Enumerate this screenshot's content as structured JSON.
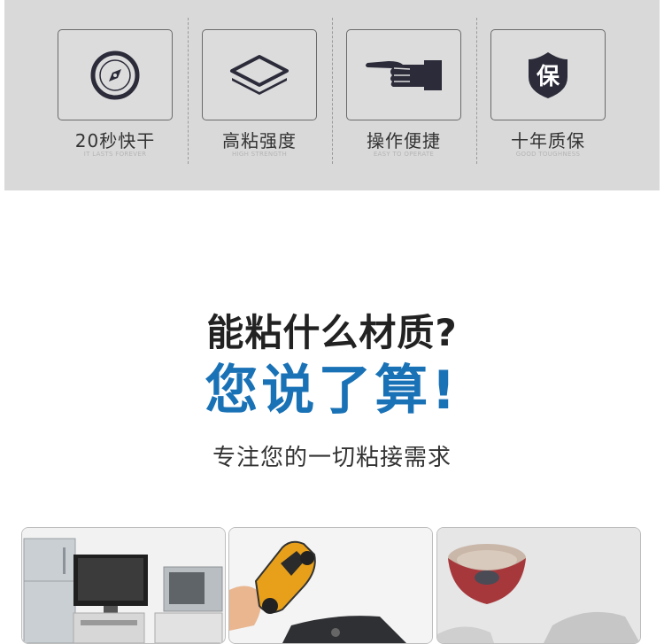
{
  "features": [
    {
      "title": "20秒快干",
      "subtitle": "IT LASTS FOREVER",
      "icon": "compass-icon"
    },
    {
      "title": "高粘强度",
      "subtitle": "HIGH STRENGTH",
      "icon": "layers-icon"
    },
    {
      "title": "操作便捷",
      "subtitle": "EASY TO OPERATE",
      "icon": "pointing-hand-icon"
    },
    {
      "title": "十年质保",
      "subtitle": "GOOD TOUGHNESS",
      "icon": "shield-badge-icon",
      "badge_char": "保"
    }
  ],
  "heading": {
    "line1": "能粘什么材质?",
    "line2": "您说了算!"
  },
  "tagline": "专注您的一切粘接需求",
  "colors": {
    "feature_bg": "#d9d9d9",
    "icon_dark": "#2b2b3a",
    "accent_blue": "#1a72b6",
    "text_dark": "#222222"
  },
  "photos": [
    "appliances-photo",
    "toy-car-photo",
    "ceramic-bowl-photo"
  ]
}
